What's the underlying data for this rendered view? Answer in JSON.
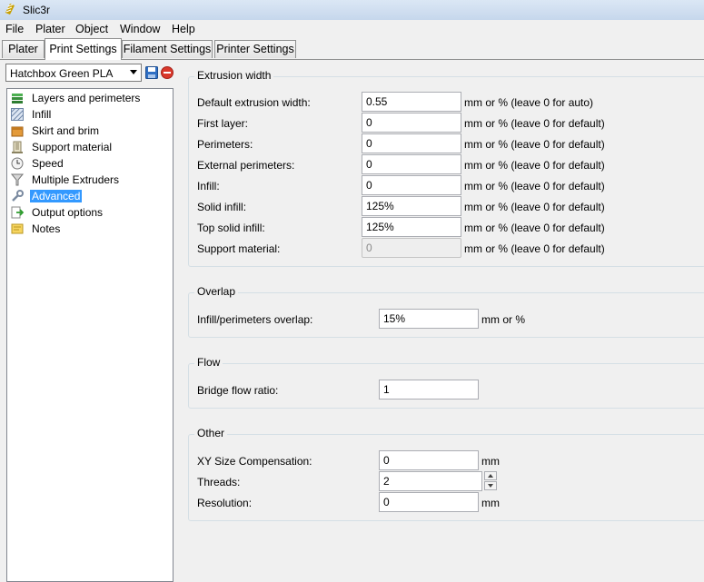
{
  "window": {
    "title": "Slic3r",
    "icon": "slic3r-logo-icon"
  },
  "menubar": {
    "items": [
      "File",
      "Plater",
      "Object",
      "Window",
      "Help"
    ]
  },
  "tabs": [
    {
      "label": "Plater",
      "active": false
    },
    {
      "label": "Print Settings",
      "active": true
    },
    {
      "label": "Filament Settings",
      "active": false
    },
    {
      "label": "Printer Settings",
      "active": false
    }
  ],
  "preset": {
    "selected": "Hatchbox Green PLA",
    "save_icon": "save-icon",
    "delete_icon": "delete-icon"
  },
  "sidebar": {
    "items": [
      {
        "label": "Layers and perimeters",
        "icon": "layers-icon",
        "selected": false
      },
      {
        "label": "Infill",
        "icon": "infill-icon",
        "selected": false
      },
      {
        "label": "Skirt and brim",
        "icon": "box-icon",
        "selected": false
      },
      {
        "label": "Support material",
        "icon": "building-icon",
        "selected": false
      },
      {
        "label": "Speed",
        "icon": "clock-icon",
        "selected": false
      },
      {
        "label": "Multiple Extruders",
        "icon": "funnel-icon",
        "selected": false
      },
      {
        "label": "Advanced",
        "icon": "wrench-icon",
        "selected": true
      },
      {
        "label": "Output options",
        "icon": "page-arrow-icon",
        "selected": false
      },
      {
        "label": "Notes",
        "icon": "note-icon",
        "selected": false
      }
    ]
  },
  "extrusion_width": {
    "title": "Extrusion width",
    "rows": [
      {
        "label": "Default extrusion width:",
        "value": "0.55",
        "unit": "mm or % (leave 0 for auto)",
        "enabled": true
      },
      {
        "label": "First layer:",
        "value": "0",
        "unit": "mm or % (leave 0 for default)",
        "enabled": true
      },
      {
        "label": "Perimeters:",
        "value": "0",
        "unit": "mm or % (leave 0 for default)",
        "enabled": true
      },
      {
        "label": "External perimeters:",
        "value": "0",
        "unit": "mm or % (leave 0 for default)",
        "enabled": true
      },
      {
        "label": "Infill:",
        "value": "0",
        "unit": "mm or % (leave 0 for default)",
        "enabled": true
      },
      {
        "label": "Solid infill:",
        "value": "125%",
        "unit": "mm or % (leave 0 for default)",
        "enabled": true
      },
      {
        "label": "Top solid infill:",
        "value": "125%",
        "unit": "mm or % (leave 0 for default)",
        "enabled": true
      },
      {
        "label": "Support material:",
        "value": "0",
        "unit": "mm or % (leave 0 for default)",
        "enabled": false
      }
    ]
  },
  "overlap": {
    "title": "Overlap",
    "rows": [
      {
        "label": "Infill/perimeters overlap:",
        "value": "15%",
        "unit": "mm or %"
      }
    ]
  },
  "flow": {
    "title": "Flow",
    "rows": [
      {
        "label": "Bridge flow ratio:",
        "value": "1",
        "unit": ""
      }
    ]
  },
  "other": {
    "title": "Other",
    "rows": [
      {
        "label": "XY Size Compensation:",
        "value": "0",
        "unit": "mm"
      },
      {
        "label": "Threads:",
        "value": "2",
        "unit": ""
      },
      {
        "label": "Resolution:",
        "value": "0",
        "unit": "mm"
      }
    ]
  }
}
